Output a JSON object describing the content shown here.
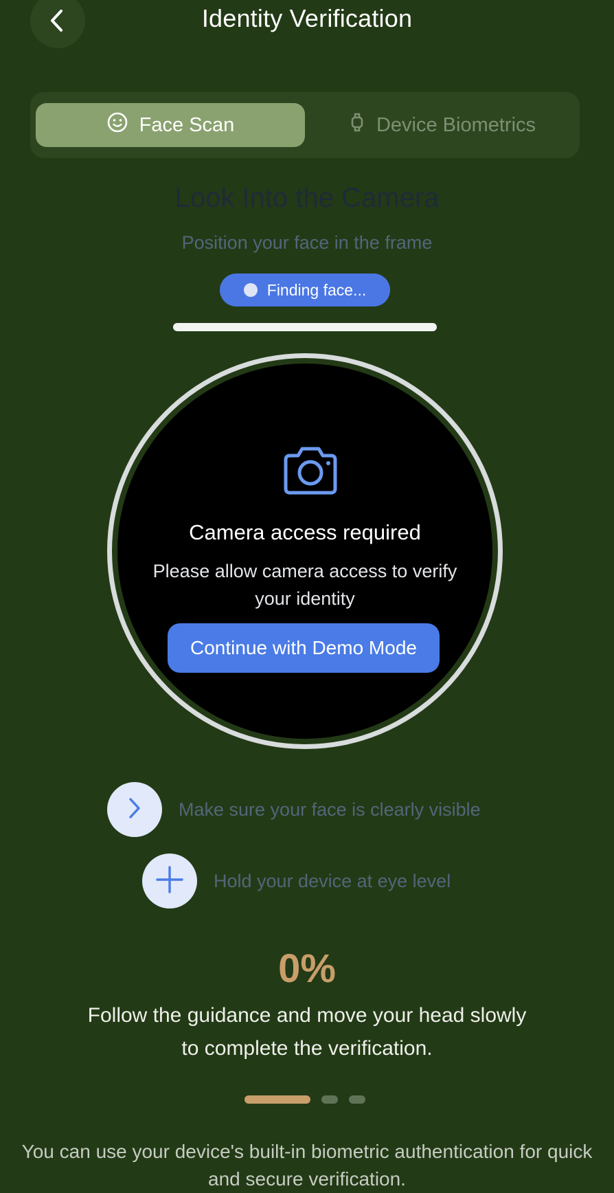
{
  "header": {
    "title": "Identity Verification",
    "back_icon": "chevron-left-icon"
  },
  "tabs": {
    "active": "face_scan",
    "face_scan": {
      "label": "Face Scan",
      "icon": "smiley-face-icon"
    },
    "device_biometrics": {
      "label": "Device Biometrics",
      "icon": "watch-icon"
    }
  },
  "scan": {
    "title": "Look Into the Camera",
    "subtitle": "Position your face in the frame",
    "status": "Finding face..."
  },
  "camera": {
    "icon": "camera-icon",
    "title": "Camera access required",
    "description": "Please allow camera access to verify your identity",
    "demo_button": "Continue with Demo Mode"
  },
  "guidance": [
    {
      "icon": "chevron-right-icon",
      "text": "Make sure your face is clearly visible"
    },
    {
      "icon": "plus-icon",
      "text": "Hold your device at eye level"
    }
  ],
  "progress": {
    "percent_label": "0%",
    "value": 0,
    "instruction": "Follow the guidance and move your head slowly to complete the verification.",
    "pager_total": 3,
    "pager_active": 1
  },
  "footer": {
    "text": "You can use your device's built-in biometric authentication for quick and secure verification."
  },
  "colors": {
    "background": "#233a16",
    "active_tab": "#8aa26f",
    "accent_blue": "#4a7be6",
    "progress_gold": "#c89e6b"
  }
}
